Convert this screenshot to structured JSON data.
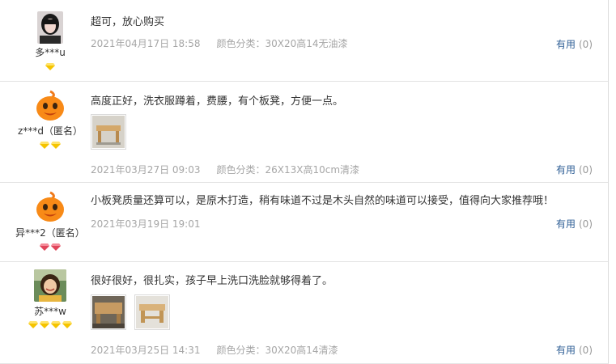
{
  "reviews": [
    {
      "username": "多***u",
      "content": "超可，放心购买",
      "date": "2021年04月17日 18:58",
      "spec": "颜色分类：30X20高14无油漆",
      "useful_label": "有用",
      "useful_count": "(0)",
      "badge_color": "gold",
      "badge_count": 1
    },
    {
      "username": "z***d（匿名）",
      "content": "高度正好，洗衣服蹲着，费腰，有个板凳，方便一点。",
      "date": "2021年03月27日 09:03",
      "spec": "颜色分类：26X13X高10cm清漆",
      "useful_label": "有用",
      "useful_count": "(0)",
      "badge_color": "gold",
      "badge_count": 2
    },
    {
      "username": "异***2（匿名）",
      "content": "小板凳质量还算可以，是原木打造，稍有味道不过是木头自然的味道可以接受，值得向大家推荐哦！",
      "date": "2021年03月19日 19:01",
      "spec": "",
      "useful_label": "有用",
      "useful_count": "(0)",
      "badge_color": "red",
      "badge_count": 2
    },
    {
      "username": "苏***w",
      "content": "很好很好，很扎实，孩子早上洗口洗脸就够得着了。",
      "date": "2021年03月25日 14:31",
      "spec": "颜色分类：30X20高14清漆",
      "useful_label": "有用",
      "useful_count": "(0)",
      "badge_color": "gold",
      "badge_count": 4
    }
  ],
  "icons": {
    "avatar_1": "woman-photo-avatar",
    "avatar_2": "orange-mascot-avatar",
    "avatar_3": "orange-mascot-avatar",
    "avatar_4": "smiling-woman-photo-avatar",
    "badge": "diamond-icon"
  },
  "colors": {
    "useful_link": "#2f5f96",
    "meta_text": "#a6a6a6",
    "badge_gold": "#f5c400",
    "badge_red": "#e0455a"
  }
}
